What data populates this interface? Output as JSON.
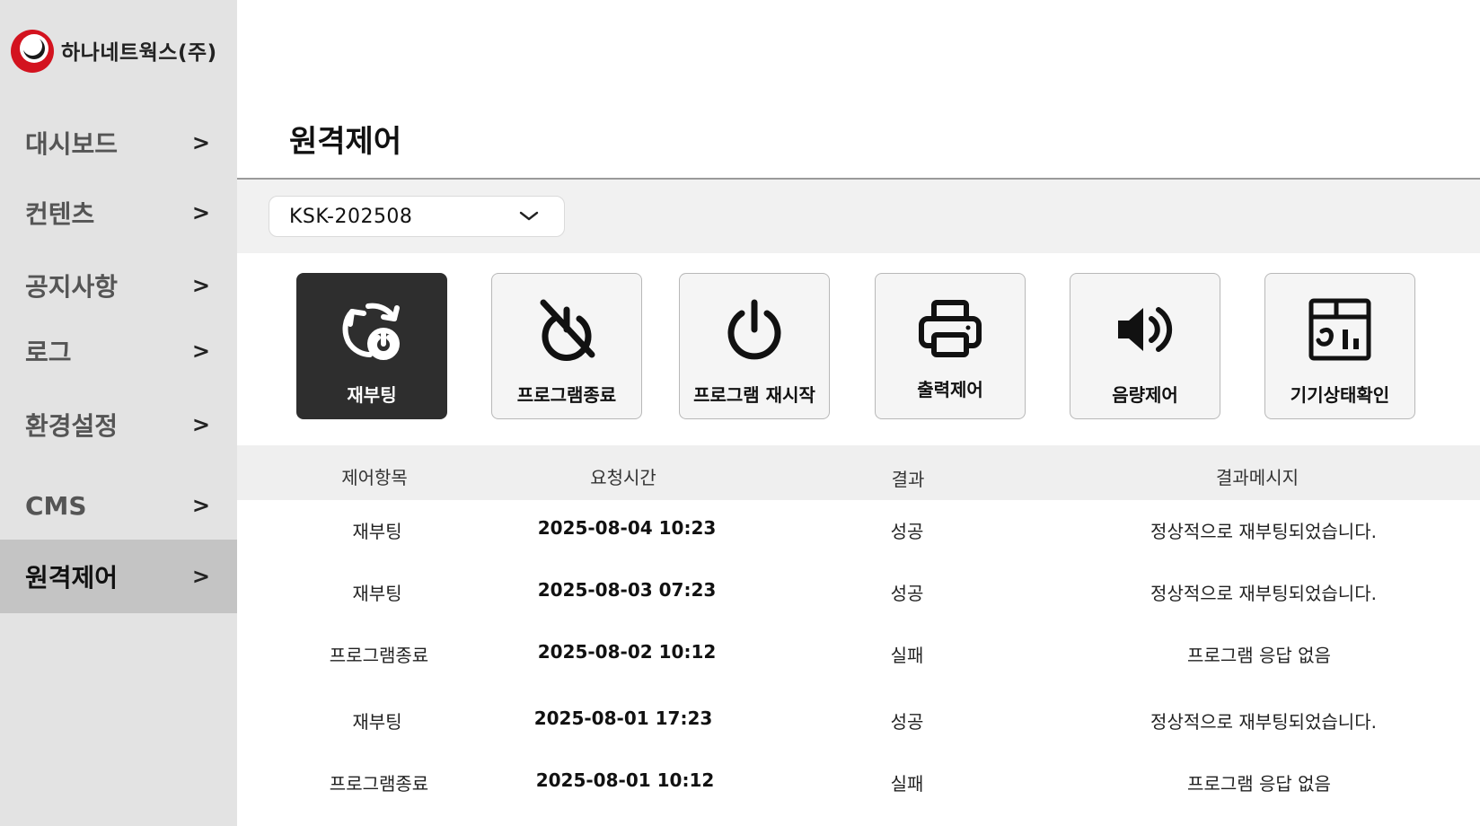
{
  "brand": {
    "name": "하나네트웍스(주)"
  },
  "colors": {
    "accent": "#d3131f",
    "active_nav_bg": "#c4c4c4",
    "dark_button_bg": "#2e2e2e"
  },
  "sidebar": {
    "items": [
      {
        "label": "대시보드",
        "arrow": ">"
      },
      {
        "label": "컨텐츠",
        "arrow": ">"
      },
      {
        "label": "공지사항",
        "arrow": ">"
      },
      {
        "label": "로그",
        "arrow": ">"
      },
      {
        "label": "환경설정",
        "arrow": ">"
      },
      {
        "label": "CMS",
        "arrow": ">"
      },
      {
        "label": "원격제어",
        "arrow": ">",
        "active": true
      }
    ]
  },
  "main": {
    "title": "원격제어",
    "device_select": {
      "value": "KSK-202508",
      "icon": "chevron-down-icon"
    },
    "controls": [
      {
        "label": "재부팅",
        "icon": "reboot-icon",
        "selected": true
      },
      {
        "label": "프로그램종료",
        "icon": "program-off-icon"
      },
      {
        "label": "프로그램 재시작",
        "icon": "power-icon"
      },
      {
        "label": "출력제어",
        "icon": "printer-icon"
      },
      {
        "label": "음량제어",
        "icon": "volume-icon"
      },
      {
        "label": "기기상태확인",
        "icon": "device-status-icon"
      }
    ],
    "table": {
      "headers": [
        "제어항목",
        "요청시간",
        "결과",
        "결과메시지"
      ],
      "rows": [
        [
          "재부팅",
          "2025-08-04 10:23",
          "성공",
          "정상적으로 재부팅되었습니다."
        ],
        [
          "재부팅",
          "2025-08-03 07:23",
          "성공",
          "정상적으로 재부팅되었습니다."
        ],
        [
          "프로그램종료",
          "2025-08-02 10:12",
          "실패",
          "프로그램 응답 없음"
        ],
        [
          "재부팅",
          "2025-08-01 17:23",
          "성공",
          "정상적으로 재부팅되었습니다."
        ],
        [
          "프로그램종료",
          "2025-08-01 10:12",
          "실패",
          "프로그램 응답 없음"
        ]
      ]
    }
  }
}
